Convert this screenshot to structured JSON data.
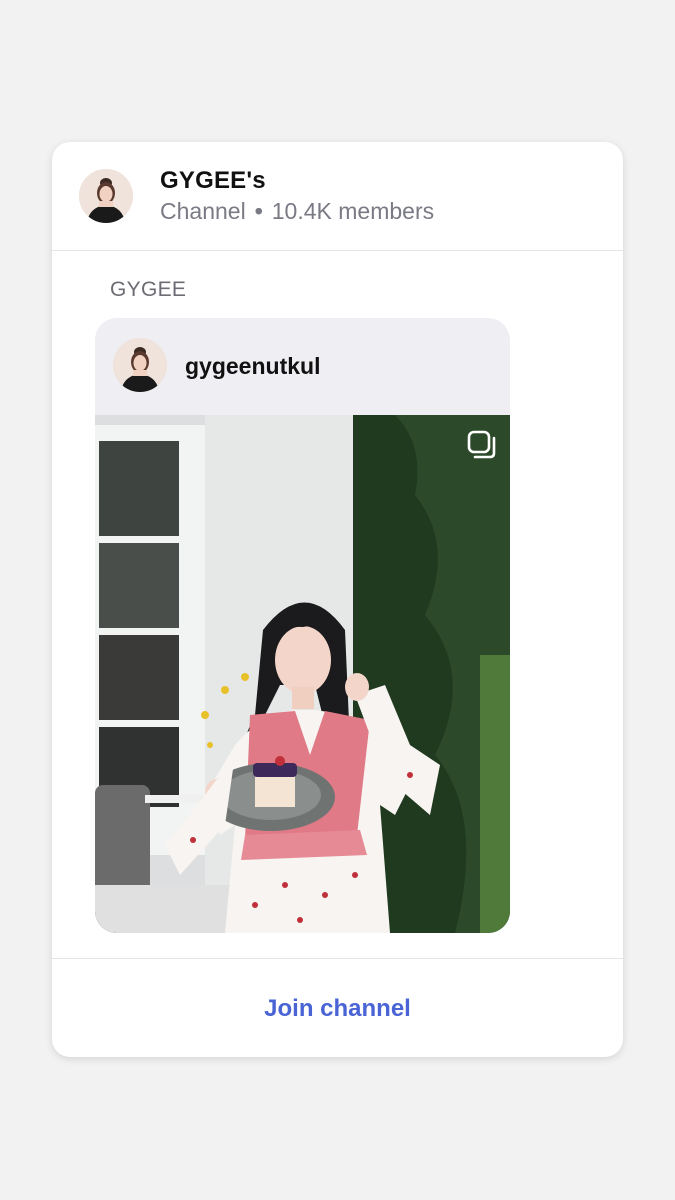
{
  "channel": {
    "title": "GYGEE's",
    "type_label": "Channel",
    "separator": "•",
    "members": "10.4K members",
    "avatar_icon": "profile-photo"
  },
  "post": {
    "author_label": "GYGEE",
    "embed": {
      "username": "gygeenutkul",
      "avatar_icon": "profile-photo",
      "media_icon": "multiple-photos-icon",
      "photo_description_icon": "photo-woman-holding-cake-plate"
    }
  },
  "footer": {
    "join_label": "Join channel"
  },
  "colors": {
    "background": "#f2f2f2",
    "card": "#ffffff",
    "accent": "#4a64d6",
    "embed_bg": "#eeeef3",
    "secondary_text": "#7a7a85"
  }
}
